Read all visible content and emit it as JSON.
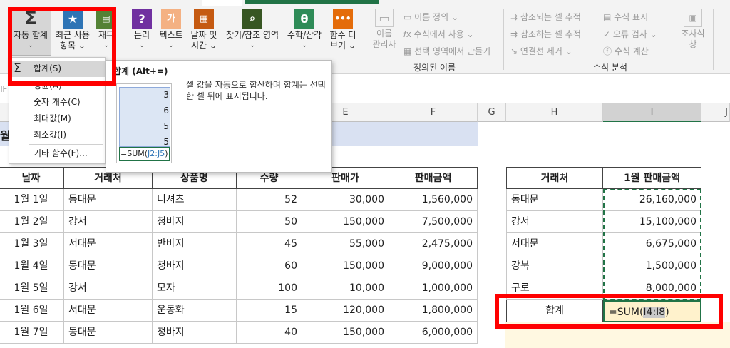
{
  "ribbon": {
    "autosum": {
      "line1": "자동 합계",
      "arrow": "⌄"
    },
    "recent": {
      "line1": "최근 사용",
      "line2": "항목 ⌄"
    },
    "finance": {
      "line1": "재무",
      "arrow": "⌄"
    },
    "logic": {
      "line1": "논리",
      "arrow": "⌄"
    },
    "text": {
      "line1": "텍스트",
      "arrow": "⌄"
    },
    "datetime": {
      "line1": "날짜 및",
      "line2": "시간 ⌄"
    },
    "lookup": {
      "line1": "찾기/참조 영역",
      "arrow": "⌄"
    },
    "math": {
      "line1": "수학/삼각",
      "arrow": "⌄"
    },
    "more": {
      "line1": "함수 더",
      "line2": "보기 ⌄"
    },
    "name_manager": {
      "line1": "이름",
      "line2": "관리자"
    },
    "define_name": "이름 정의",
    "use_in_formula": "수식에서 사용",
    "create_from_selection": "선택 영역에서 만들기",
    "defined_names_group": "정의된 이름",
    "trace_precedents": "참조되는 셀 추적",
    "trace_dependents": "참조하는 셀 추적",
    "remove_arrows": "연결선 제거",
    "show_formulas": "수식 표시",
    "error_checking": "오류 검사",
    "evaluate_formula": "수식 계산",
    "watch_window": {
      "line1": "조사식",
      "line2": "창"
    },
    "formula_auditing_group": "수식 분석"
  },
  "autosum_menu": {
    "items": [
      "합계(S)",
      "평균(A)",
      "숫자 개수(C)",
      "최대값(M)",
      "최소값(I)",
      "기타 함수(F)..."
    ]
  },
  "tooltip": {
    "title": "합계 (Alt+=)",
    "description": "셀 값을 자동으로 합산하며 합계는 선택한 셀 뒤에 표시됩니다.",
    "sample_values": [
      "3",
      "6",
      "5",
      "5"
    ],
    "sample_formula_prefix": "=SUM(",
    "sample_formula_range": "J2:J5",
    "sample_formula_suffix": ")"
  },
  "formula_bar": {
    "name_box_fragment": "IF"
  },
  "columns": [
    "E",
    "F",
    "G",
    "H",
    "I",
    "J"
  ],
  "sheet": {
    "title_fragment": "월",
    "headers": [
      "날짜",
      "거래처",
      "상품명",
      "수량",
      "판매가",
      "판매금액"
    ],
    "rows": [
      [
        "1월 1일",
        "동대문",
        "티셔츠",
        "52",
        "30,000",
        "1,560,000"
      ],
      [
        "1월 2일",
        "강서",
        "청바지",
        "50",
        "150,000",
        "7,500,000"
      ],
      [
        "1월 3일",
        "서대문",
        "반바지",
        "45",
        "55,000",
        "2,475,000"
      ],
      [
        "1월 4일",
        "동대문",
        "청바지",
        "60",
        "150,000",
        "9,000,000"
      ],
      [
        "1월 5일",
        "강서",
        "모자",
        "100",
        "10,000",
        "1,000,000"
      ],
      [
        "1월 6일",
        "서대문",
        "운동화",
        "15",
        "120,000",
        "1,800,000"
      ],
      [
        "1월 7일",
        "동대문",
        "청바지",
        "40",
        "150,000",
        "6,000,000"
      ]
    ]
  },
  "summary": {
    "headers": [
      "거래처",
      "1월 판매금액"
    ],
    "rows": [
      [
        "동대문",
        "26,160,000"
      ],
      [
        "강서",
        "15,100,000"
      ],
      [
        "서대문",
        "6,675,000"
      ],
      [
        "강북",
        "1,500,000"
      ],
      [
        "구로",
        "8,000,000"
      ]
    ],
    "total_label": "합계",
    "formula_prefix": "=SUM(",
    "formula_range": "I4:I8",
    "formula_suffix": ")"
  },
  "colors": {
    "highlight_red": "#ff0000",
    "excel_green": "#217346",
    "title_band": "#d9e1f2",
    "formula_cell": "#fff2cc",
    "selection_blue": "#dce6f4"
  }
}
